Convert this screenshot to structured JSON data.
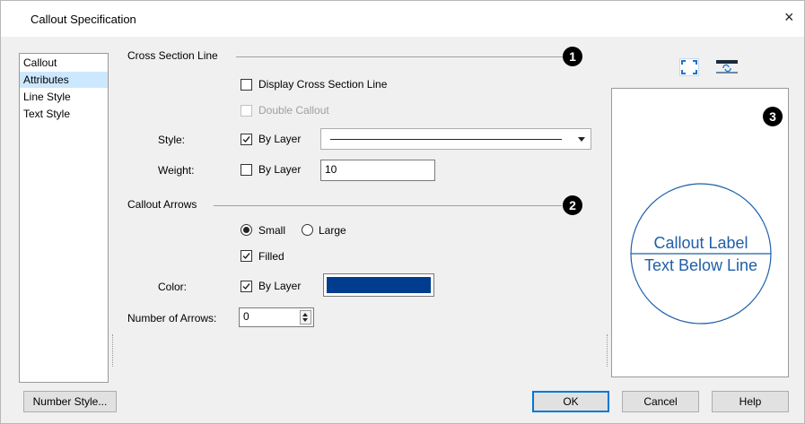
{
  "window": {
    "title": "Callout Specification",
    "close_glyph": "×"
  },
  "sidebar": {
    "items": [
      {
        "label": "Callout",
        "selected": false
      },
      {
        "label": "Attributes",
        "selected": true
      },
      {
        "label": "Line Style",
        "selected": false
      },
      {
        "label": "Text Style",
        "selected": false
      }
    ]
  },
  "cross_section": {
    "heading": "Cross Section Line",
    "badge": "1",
    "display_label": "Display Cross Section Line",
    "display_checked": false,
    "double_label": "Double Callout",
    "double_checked": false,
    "double_disabled": true,
    "style_label": "Style:",
    "style_bylayer_label": "By Layer",
    "style_bylayer_checked": true,
    "weight_label": "Weight:",
    "weight_bylayer_label": "By Layer",
    "weight_bylayer_checked": false,
    "weight_value": "10"
  },
  "callout_arrows": {
    "heading": "Callout Arrows",
    "badge": "2",
    "small_label": "Small",
    "large_label": "Large",
    "size_selected": "Small",
    "filled_label": "Filled",
    "filled_checked": true,
    "color_label": "Color:",
    "color_bylayer_label": "By Layer",
    "color_bylayer_checked": true,
    "color_value": "#003d8f",
    "number_label": "Number of Arrows:",
    "number_value": "0"
  },
  "preview": {
    "badge": "3",
    "label_above": "Callout Label",
    "label_below": "Text Below Line",
    "stroke_color": "#1f5fa8"
  },
  "buttons": {
    "number_style": "Number Style...",
    "ok": "OK",
    "cancel": "Cancel",
    "help": "Help"
  },
  "icons": {
    "fit_view": "fit-view-icon",
    "swap_view": "swap-view-icon"
  }
}
